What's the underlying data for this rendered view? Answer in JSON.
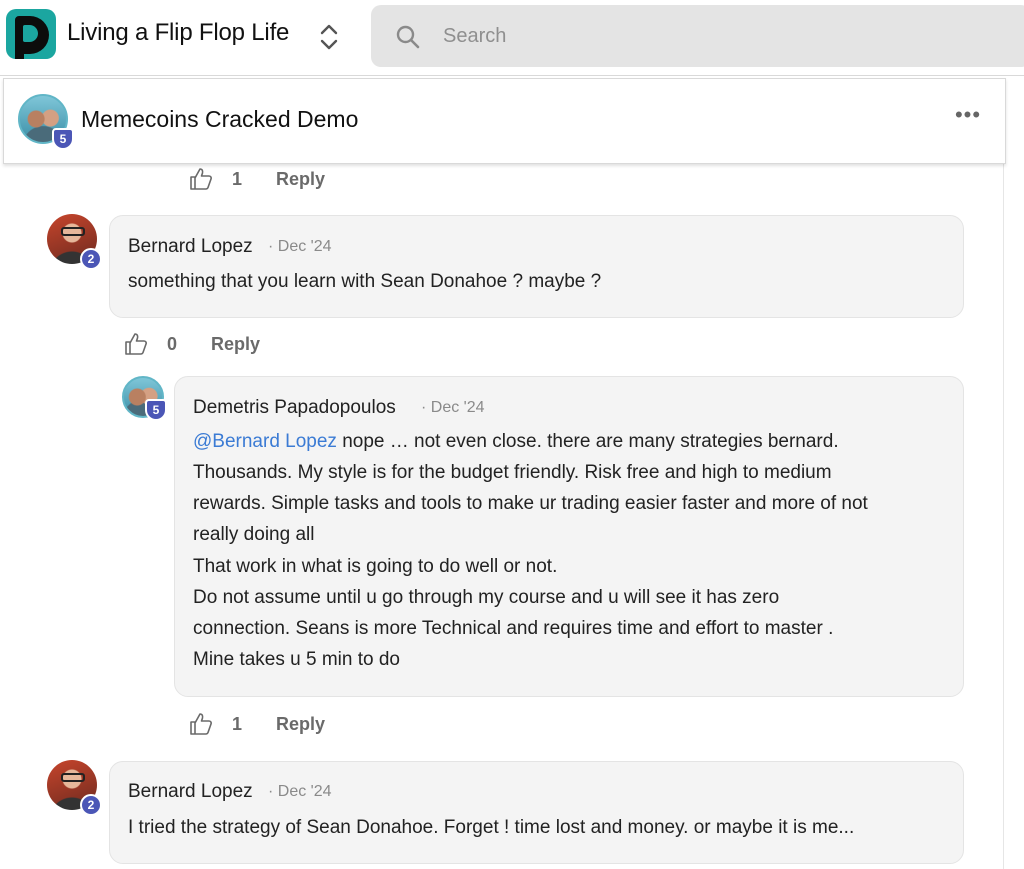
{
  "header": {
    "group_name": "Living a Flip Flop Life",
    "search_placeholder": "Search"
  },
  "post": {
    "title": "Memecoins Cracked Demo",
    "author_level": "5",
    "more_label": "•••"
  },
  "action_bar_top": {
    "likes": "1",
    "reply_label": "Reply"
  },
  "comments": [
    {
      "author": "Bernard Lopez",
      "date": "· Dec '24",
      "level": "2",
      "text": "something that you learn with Sean Donahoe ? maybe ?",
      "likes": "0",
      "reply_label": "Reply"
    },
    {
      "author": "Demetris Papadopoulos",
      "date": "· Dec '24",
      "level": "5",
      "mention": "@Bernard Lopez",
      "text_line1": " nope … not even close. there are many strategies bernard.",
      "text_rest": "Thousands. My style is for the budget friendly. Risk free and high to medium\nrewards. Simple tasks and tools to make ur trading easier faster and more of not\nreally doing all\nThat work in what is going to do well or not.\nDo not assume until u go through my course and u will see it has zero\nconnection. Seans is more Technical and requires time and effort to master .\nMine takes u 5 min to do",
      "likes": "1",
      "reply_label": "Reply"
    },
    {
      "author": "Bernard Lopez",
      "date": "· Dec '24",
      "level": "2",
      "text": "I tried the strategy of Sean Donahoe. Forget ! time lost and money. or maybe it is me..."
    }
  ],
  "icons": {
    "logo": "dark-d-logo",
    "switcher": "chevron-up-down-icon",
    "search": "search-icon",
    "like": "thumbs-up-icon"
  },
  "colors": {
    "accent_teal": "#1ba6a0",
    "badge_blue": "#4b56b6",
    "mention_blue": "#3b7bd4",
    "bubble_bg": "#f4f4f4",
    "search_bg": "#e4e4e4"
  }
}
